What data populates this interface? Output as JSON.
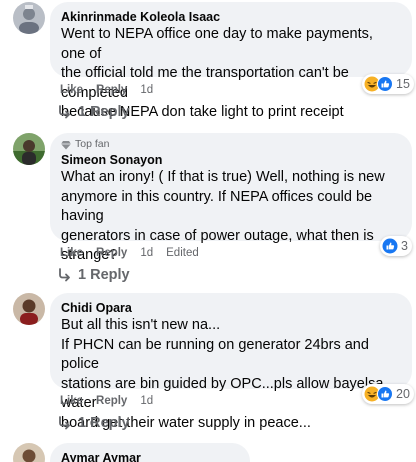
{
  "comments": [
    {
      "author": "Akinrinmade Koleola Isaac",
      "top_fan": "",
      "lines": [
        "Went to NEPA office one day to make payments, one of",
        "the official told me the transportation can't be completed",
        "because NEPA don take light to print receipt"
      ],
      "actions": {
        "like": "Like",
        "reply": "Reply",
        "time": "1d",
        "edited": ""
      },
      "reactions": {
        "icons": [
          "haha-icon",
          "like-icon"
        ],
        "count": "15"
      },
      "replies_label": "1 Reply"
    },
    {
      "author": "Simeon Sonayon",
      "top_fan": "Top fan",
      "lines": [
        "What an irony! ( If that is true) Well, nothing is new",
        "anymore in this country. If NEPA offices could be having",
        "generators in case of power outage, what then is",
        "strange?"
      ],
      "actions": {
        "like": "Like",
        "reply": "Reply",
        "time": "1d",
        "edited": "Edited"
      },
      "reactions": {
        "icons": [
          "like-icon"
        ],
        "count": "3"
      },
      "replies_label": "1 Reply"
    },
    {
      "author": "Chidi Opara",
      "top_fan": "",
      "lines": [
        "But all this isn't new na...",
        "If PHCN can be running on generator 24brs and police",
        "stations are bin guided by OPC...pls allow bayelsa water",
        "board get their water supply in peace..."
      ],
      "actions": {
        "like": "Like",
        "reply": "Reply",
        "time": "1d",
        "edited": ""
      },
      "reactions": {
        "icons": [
          "haha-icon",
          "like-icon"
        ],
        "count": "20"
      },
      "replies_label": "1 Reply"
    },
    {
      "author": "Aymar Aymar"
    }
  ],
  "colors": {
    "bubble": "#f0f2f5",
    "secondary_text": "#65676b",
    "like_blue": "#1877f2",
    "haha_yellow": "#f7b125"
  }
}
